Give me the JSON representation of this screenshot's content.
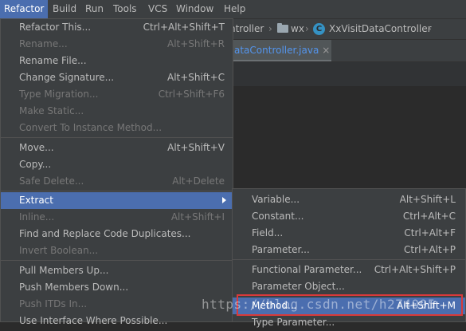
{
  "menubar": {
    "items": [
      {
        "label": "Refactor",
        "active": true
      },
      {
        "label": "Build"
      },
      {
        "label": "Run"
      },
      {
        "label": "Tools"
      },
      {
        "label": "VCS"
      },
      {
        "label": "Window"
      },
      {
        "label": "Help"
      }
    ]
  },
  "breadcrumb": {
    "segment1": "ntroller",
    "folder": "wx",
    "class_letter": "C",
    "class_name": "XxVisitDataController"
  },
  "editor_tab": {
    "label": "ataController.java",
    "close": "×"
  },
  "refactor_menu": {
    "items": [
      {
        "label": "Refactor This...",
        "shortcut": "Ctrl+Alt+Shift+T"
      },
      {
        "label": "Rename...",
        "shortcut": "Alt+Shift+R",
        "disabled": true
      },
      {
        "label": "Rename File...",
        "shortcut": ""
      },
      {
        "label": "Change Signature...",
        "shortcut": "Alt+Shift+C"
      },
      {
        "label": "Type Migration...",
        "shortcut": "Ctrl+Shift+F6",
        "disabled": true
      },
      {
        "label": "Make Static...",
        "shortcut": "",
        "disabled": true
      },
      {
        "label": "Convert To Instance Method...",
        "shortcut": "",
        "disabled": true
      },
      {
        "label": "Move...",
        "shortcut": "Alt+Shift+V"
      },
      {
        "label": "Copy...",
        "shortcut": ""
      },
      {
        "label": "Safe Delete...",
        "shortcut": "Alt+Delete",
        "disabled": true
      },
      {
        "label": "Extract",
        "shortcut": "",
        "selected": true,
        "submenu": true
      },
      {
        "label": "Inline...",
        "shortcut": "Alt+Shift+I",
        "disabled": true
      },
      {
        "label": "Find and Replace Code Duplicates...",
        "shortcut": ""
      },
      {
        "label": "Invert Boolean...",
        "shortcut": "",
        "disabled": true
      },
      {
        "label": "Pull Members Up...",
        "shortcut": ""
      },
      {
        "label": "Push Members Down...",
        "shortcut": ""
      },
      {
        "label": "Push ITDs In...",
        "shortcut": "",
        "disabled": true
      },
      {
        "label": "Use Interface Where Possible...",
        "shortcut": ""
      }
    ]
  },
  "extract_submenu": {
    "items": [
      {
        "label": "Variable...",
        "shortcut": "Alt+Shift+L"
      },
      {
        "label": "Constant...",
        "shortcut": "Ctrl+Alt+C"
      },
      {
        "label": "Field...",
        "shortcut": "Ctrl+Alt+F"
      },
      {
        "label": "Parameter...",
        "shortcut": "Ctrl+Alt+P"
      },
      {
        "label": "Functional Parameter...",
        "shortcut": "Ctrl+Alt+Shift+P"
      },
      {
        "label": "Parameter Object...",
        "shortcut": ""
      },
      {
        "label": "Method...",
        "shortcut": "Alt+Shift+M",
        "selected": true
      },
      {
        "label": "Type Parameter...",
        "shortcut": ""
      }
    ]
  },
  "watermark": "https://blog.csdn.net/h274095"
}
